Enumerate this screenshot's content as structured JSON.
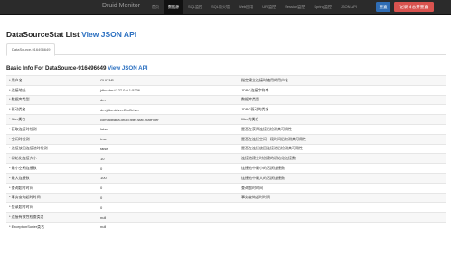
{
  "navbar": {
    "brand": "Druid Monitor",
    "items": [
      {
        "label": "首页",
        "active": false
      },
      {
        "label": "数据源",
        "active": true
      },
      {
        "label": "SQL监控",
        "active": false
      },
      {
        "label": "SQL防火墙",
        "active": false
      },
      {
        "label": "Web应用",
        "active": false
      },
      {
        "label": "URI监控",
        "active": false
      },
      {
        "label": "Session监控",
        "active": false
      },
      {
        "label": "Spring监控",
        "active": false
      },
      {
        "label": "JSON API",
        "active": false
      }
    ],
    "reset_button": "重置",
    "record_button": "记录日志并重置"
  },
  "page": {
    "title": "DataSourceStat List",
    "title_link": "View JSON API",
    "tab": "DataSource-916496649",
    "section_title": "Basic Info For DataSource-916496649",
    "section_link": "View JSON API"
  },
  "rows": [
    {
      "name": "* 用户名",
      "value": "GUITAR",
      "desc": "指定建立连接时使用的用户名"
    },
    {
      "name": "* 连接地址",
      "value": "jdbc:dm://127.0.0.1:5236",
      "desc": "JDBC连接字符串"
    },
    {
      "name": "* 数据库类型",
      "value": "dm",
      "desc": "数据库类型"
    },
    {
      "name": "* 驱动类名",
      "value": "dm.jdbc.driver.DmDriver",
      "desc": "JDBC驱动的类名"
    },
    {
      "name": "* filter类名",
      "value": "com.alibaba.druid.filter.stat.StatFilter",
      "desc": "filter的类名"
    },
    {
      "name": "* 获取连接时检测",
      "value": "false",
      "desc": "是否在获得连接后检测其可用性"
    },
    {
      "name": "* 空闲时检测",
      "value": "true",
      "desc": "是否在连接空闲一段时间后检测其可用性"
    },
    {
      "name": "* 连接放回连接池时检测",
      "value": "false",
      "desc": "是否在连接放回连接池后检测其可用性"
    },
    {
      "name": "* 初始化连接大小",
      "value": "10",
      "desc": "连接池建立时创建的初始化连接数"
    },
    {
      "name": "* 最小空闲连接数",
      "value": "0",
      "desc": "连接池中最小的活跃连接数"
    },
    {
      "name": "* 最大连接数",
      "value": "100",
      "desc": "连接池中最大的活跃连接数"
    },
    {
      "name": "* 查询超时时间",
      "value": "0",
      "desc": "查询超时时间"
    },
    {
      "name": "* 事务查询超时时间",
      "value": "0",
      "desc": "事务查询超时时间"
    },
    {
      "name": "* 登录超时时间",
      "value": "0",
      "desc": ""
    },
    {
      "name": "* 连接有效性检查类名",
      "value": "null",
      "desc": ""
    },
    {
      "name": "* ExceptionSorter类名",
      "value": "null",
      "desc": ""
    }
  ]
}
